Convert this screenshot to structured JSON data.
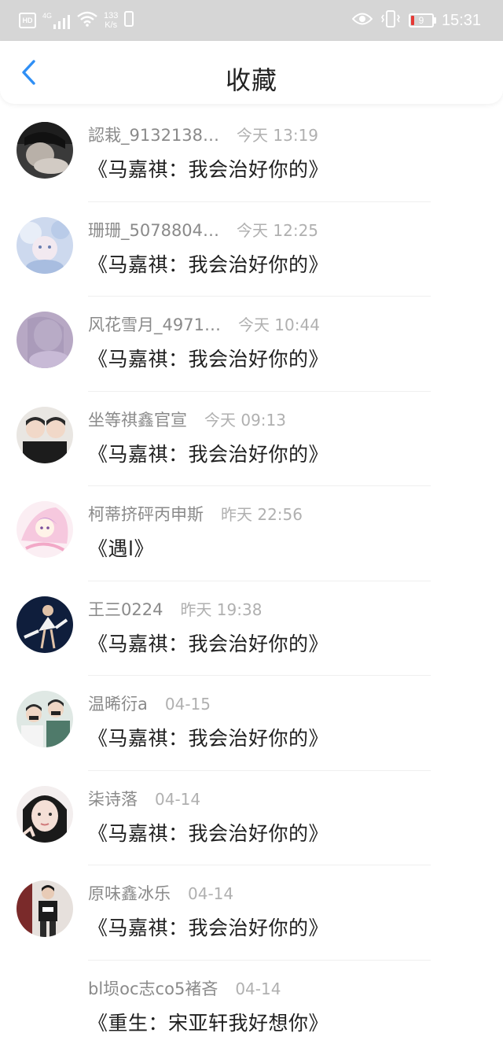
{
  "status_bar": {
    "hd": "HD",
    "signal": "4G",
    "netspeed_value": "133",
    "netspeed_unit": "K/s",
    "battery": "9",
    "time": "15:31"
  },
  "header": {
    "title": "收藏",
    "back_icon": "chevron-left-icon"
  },
  "items": [
    {
      "username": "認栽_9132138…",
      "time": "今天 13:19",
      "title": "《马嘉祺：我会治好你的》"
    },
    {
      "username": "珊珊_5078804…",
      "time": "今天 12:25",
      "title": "《马嘉祺：我会治好你的》"
    },
    {
      "username": "风花雪月_4971…",
      "time": "今天 10:44",
      "title": "《马嘉祺：我会治好你的》"
    },
    {
      "username": "坐等祺鑫官宣",
      "time": "今天 09:13",
      "title": "《马嘉祺：我会治好你的》"
    },
    {
      "username": "柯蒂挤砰丙申斯",
      "time": "昨天 22:56",
      "title": "《遇l》"
    },
    {
      "username": "王三0224",
      "time": "昨天 19:38",
      "title": "《马嘉祺：我会治好你的》"
    },
    {
      "username": "温晞衍a",
      "time": "04-15",
      "title": "《马嘉祺：我会治好你的》"
    },
    {
      "username": "柒诗落",
      "time": "04-14",
      "title": "《马嘉祺：我会治好你的》"
    },
    {
      "username": "原味鑫冰乐",
      "time": "04-14",
      "title": "《马嘉祺：我会治好你的》"
    },
    {
      "username": "bl埙oc志co5褚吝",
      "time": "04-14",
      "title": "《重生：宋亚轩我好想你》"
    }
  ],
  "colors": {
    "accent": "#2f8ff5",
    "status_bar_bg": "#d6d6d6",
    "username": "#8a8a8a",
    "time": "#b0b0b0",
    "title": "#1f1f1f"
  }
}
